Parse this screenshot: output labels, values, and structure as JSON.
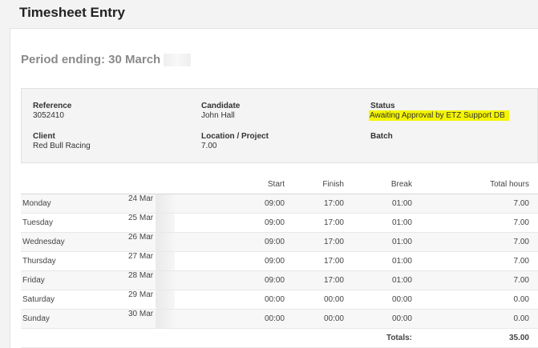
{
  "header": {
    "title": "Timesheet Entry"
  },
  "period": {
    "label": "Period ending: 30 March"
  },
  "info": {
    "reference": {
      "label": "Reference",
      "value": "3052410"
    },
    "candidate": {
      "label": "Candidate",
      "value": "John Hall"
    },
    "status": {
      "label": "Status",
      "value": "Awaiting Approval by ETZ Support DB"
    },
    "client": {
      "label": "Client",
      "value": "Red Bull Racing"
    },
    "location": {
      "label": "Location / Project",
      "value": "7.00"
    },
    "batch": {
      "label": "Batch",
      "value": ""
    }
  },
  "table": {
    "columns": [
      "",
      "",
      "Start",
      "Finish",
      "Break",
      "Total hours"
    ],
    "rows": [
      {
        "day": "Monday",
        "date": "24 Mar",
        "start": "09:00",
        "finish": "17:00",
        "break": "01:00",
        "total": "7.00"
      },
      {
        "day": "Tuesday",
        "date": "25 Mar",
        "start": "09:00",
        "finish": "17:00",
        "break": "01:00",
        "total": "7.00"
      },
      {
        "day": "Wednesday",
        "date": "26 Mar",
        "start": "09:00",
        "finish": "17:00",
        "break": "01:00",
        "total": "7.00"
      },
      {
        "day": "Thursday",
        "date": "27 Mar",
        "start": "09:00",
        "finish": "17:00",
        "break": "01:00",
        "total": "7.00"
      },
      {
        "day": "Friday",
        "date": "28 Mar",
        "start": "09:00",
        "finish": "17:00",
        "break": "01:00",
        "total": "7.00"
      },
      {
        "day": "Saturday",
        "date": "29 Mar",
        "start": "00:00",
        "finish": "00:00",
        "break": "00:00",
        "total": "0.00"
      },
      {
        "day": "Sunday",
        "date": "30 Mar",
        "start": "00:00",
        "finish": "00:00",
        "break": "00:00",
        "total": "0.00"
      }
    ],
    "totals_label": "Totals:",
    "totals_value": "35.00"
  }
}
